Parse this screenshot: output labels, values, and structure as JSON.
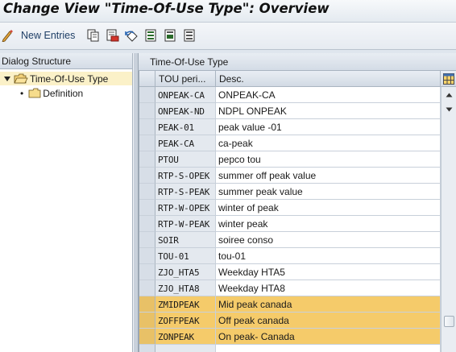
{
  "window": {
    "title": "Change View \"Time-Of-Use Type\": Overview"
  },
  "toolbar": {
    "new_entries_label": "New Entries",
    "icons": [
      "change-display-icon",
      "copy-icon",
      "delete-icon",
      "undo-icon",
      "select-all-icon",
      "select-block-icon",
      "deselect-all-icon"
    ]
  },
  "left_pane": {
    "header": "Dialog Structure",
    "tree": [
      {
        "label": "Time-Of-Use Type",
        "expanded": true,
        "selected": true,
        "icon": "folder-open-icon"
      },
      {
        "label": "Definition",
        "expanded": false,
        "selected": false,
        "icon": "folder-icon"
      }
    ]
  },
  "right_pane": {
    "title": "Time-Of-Use Type",
    "columns": [
      "TOU peri...",
      "Desc."
    ],
    "rows": [
      {
        "key": "ONPEAK-CA",
        "desc": "ONPEAK-CA",
        "highlighted": false
      },
      {
        "key": "ONPEAK-ND",
        "desc": "NDPL ONPEAK",
        "highlighted": false
      },
      {
        "key": "PEAK-01",
        "desc": "peak value -01",
        "highlighted": false
      },
      {
        "key": "PEAK-CA",
        "desc": "ca-peak",
        "highlighted": false
      },
      {
        "key": "PTOU",
        "desc": "pepco tou",
        "highlighted": false
      },
      {
        "key": "RTP-S-OPEK",
        "desc": "summer off peak value",
        "highlighted": false
      },
      {
        "key": "RTP-S-PEAK",
        "desc": "summer peak value",
        "highlighted": false
      },
      {
        "key": "RTP-W-OPEK",
        "desc": "winter of peak",
        "highlighted": false
      },
      {
        "key": "RTP-W-PEAK",
        "desc": "winter peak",
        "highlighted": false
      },
      {
        "key": "SOIR",
        "desc": "soiree conso",
        "highlighted": false
      },
      {
        "key": "TOU-01",
        "desc": "tou-01",
        "highlighted": false
      },
      {
        "key": "ZJO_HTA5",
        "desc": "Weekday HTA5",
        "highlighted": false
      },
      {
        "key": "ZJO_HTA8",
        "desc": "Weekday HTA8",
        "highlighted": false
      },
      {
        "key": "ZMIDPEAK",
        "desc": "Mid peak canada",
        "highlighted": true
      },
      {
        "key": "ZOFFPEAK",
        "desc": "Off peak canada",
        "highlighted": true
      },
      {
        "key": "ZONPEAK",
        "desc": "On peak- Canada",
        "highlighted": true
      },
      {
        "key": "",
        "desc": "",
        "highlighted": false
      }
    ],
    "scroll_position": 0.9
  },
  "colors": {
    "highlight": "#f5cb6a",
    "tree_selected": "#fbf1c8",
    "header_bg": "#d4dce6"
  }
}
